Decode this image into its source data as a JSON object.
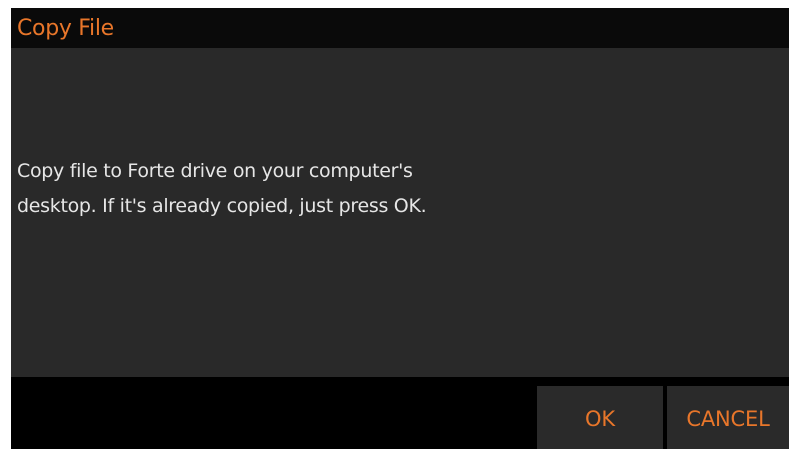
{
  "dialog": {
    "title": "Copy File",
    "message": "Copy file to Forte drive on your computer's\ndesktop. If it's already copied, just press OK.",
    "buttons": {
      "ok_label": "OK",
      "cancel_label": "CANCEL"
    }
  },
  "colors": {
    "accent": "#e8762a",
    "content_background": "#292929",
    "chrome_background": "#000000",
    "text": "#e6e6e6"
  }
}
